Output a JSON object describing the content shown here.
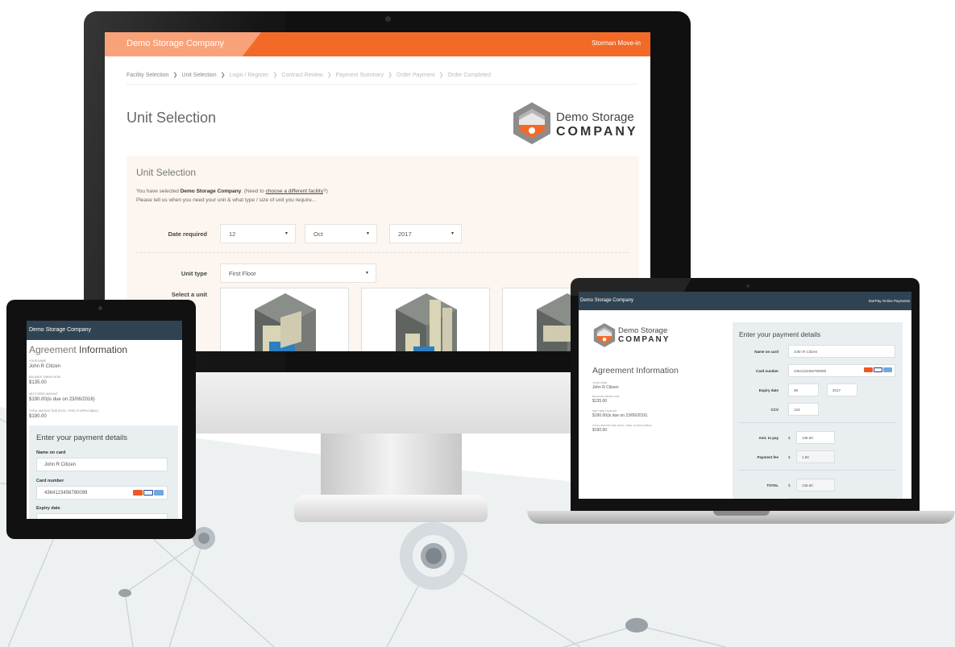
{
  "imac": {
    "brand": "Demo Storage Company",
    "header_right": "Storman Move-in",
    "breadcrumbs": [
      "Facility Selection",
      "Unit Selection",
      "Login / Register",
      "Contract Review",
      "Payment Summary",
      "Order Payment",
      "Order Completed"
    ],
    "page_title": "Unit Selection",
    "logo_line1": "Demo Storage",
    "logo_line2": "COMPANY",
    "panel_title": "Unit Selection",
    "intro_prefix": "You have selected ",
    "intro_facility": "Demo Storage Company",
    "intro_middle": ". (Need to ",
    "intro_link": "choose a different facility",
    "intro_suffix": "?)",
    "intro_line2": "Please tell us when you need your unit & what type / size of unit you require...",
    "date_label": "Date required",
    "date_day": "12",
    "date_month": "Oct",
    "date_year": "2017",
    "unit_type_label": "Unit type",
    "unit_type_value": "First Floor",
    "select_unit_label": "Select a unit"
  },
  "tablet": {
    "header": "Demo Storage Company",
    "title_light": "Agreement",
    "title_bold": "Information",
    "your_name_label": "YOUR NAME",
    "your_name": "John R Citizen",
    "balance_label": "BALANCE OWING NOW",
    "balance": "$135.00",
    "next_rent_label": "NEXT RENT AMOUNT",
    "next_rent": "$190.00(is due on 23/06/2016)",
    "total_label": "TOTAL AMOUNT DUE (EXCL. FEES, IF APPLICABLE)",
    "total": "$190.00",
    "form_title": "Enter your payment details",
    "name_on_card_label": "Name on card",
    "name_on_card": "John R Citizen",
    "card_number_label": "Card number",
    "card_number": "4364123456780099",
    "expiry_label": "Expiry date"
  },
  "laptop": {
    "header": "Demo Storage Company",
    "header_right": "StorPay Online Payments",
    "logo_line1": "Demo Storage",
    "logo_line2": "COMPANY",
    "agreement_title": "Agreement Information",
    "your_name_label": "YOUR NAME",
    "your_name": "John R Citizen",
    "balance_label": "BALANCE OWING NOW",
    "balance": "$135.00",
    "next_rent_label": "NEXT RENT AMOUNT",
    "next_rent": "$190.00(is due on 23/06/2016)",
    "total_label": "TOTAL AMOUNT DUE (EXCL. FEES, IF APPLICABLE)",
    "total": "$190.00",
    "form_title": "Enter your payment details",
    "name_on_card_label": "Name on card",
    "name_on_card": "John R Citizen",
    "card_number_label": "Card number",
    "card_number": "4364123456780099",
    "expiry_label": "Expiry date",
    "expiry_month": "08",
    "expiry_year": "2017",
    "ccv_label": "CCV",
    "ccv": "123",
    "amt_label": "Amt. to pay",
    "currency": "$",
    "amt": "135.00",
    "fee_label": "Payment fee",
    "fee": "1.50",
    "total_pay_label": "TOTAL",
    "total_pay": "136.50"
  },
  "colors": {
    "accent": "#f36a28",
    "accent_light": "#f9a27a",
    "navy": "#2f4352",
    "panel_bg": "#fdf6f0",
    "form_bg": "#e9eff1"
  }
}
